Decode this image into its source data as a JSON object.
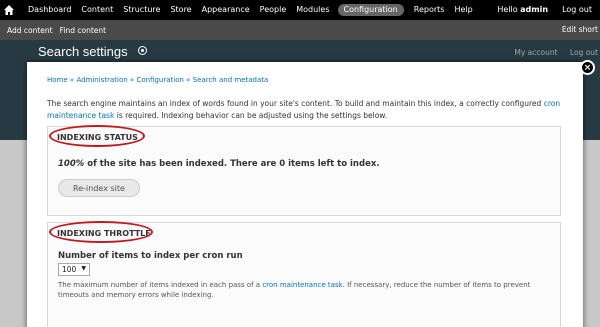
{
  "toolbar": {
    "items": [
      "Dashboard",
      "Content",
      "Structure",
      "Store",
      "Appearance",
      "People",
      "Modules",
      "Configuration",
      "Reports",
      "Help"
    ],
    "active": "Configuration",
    "hello": "Hello",
    "user": "admin",
    "logout": "Log out"
  },
  "shortcuts": {
    "add_content": "Add content",
    "find_content": "Find content",
    "edit_shortcuts": "Edit short"
  },
  "header": {
    "title": "Search settings",
    "my_account": "My account",
    "log_out": "Log out"
  },
  "modal": {
    "close_label": "×",
    "breadcrumb": {
      "home": "Home",
      "administration": "Administration",
      "configuration": "Configuration",
      "search_metadata": "Search and metadata",
      "sep": "»"
    },
    "intro": {
      "before": "The search engine maintains an index of words found in your site's content. To build and maintain this index, a correctly configured ",
      "link": "cron maintenance task",
      "after": " is required. Indexing behavior can be adjusted using the settings below."
    },
    "indexing_status": {
      "legend": "INDEXING STATUS",
      "percent": "100%",
      "status_text": " of the site has been indexed. There are 0 items left to index.",
      "reindex_button": "Re-index site"
    },
    "indexing_throttle": {
      "legend": "INDEXING THROTTLE",
      "field_label": "Number of items to index per cron run",
      "selected": "100",
      "desc_before": "The maximum number of items indexed in each pass of a ",
      "desc_link": "cron maintenance task",
      "desc_after": ". If necessary, reduce the number of items to prevent timeouts and memory errors while indexing."
    }
  },
  "colors": {
    "link": "#0074bd",
    "highlight_ring": "#c4171c",
    "toolbar_bg": "#000000",
    "header_bg": "#273a44"
  }
}
